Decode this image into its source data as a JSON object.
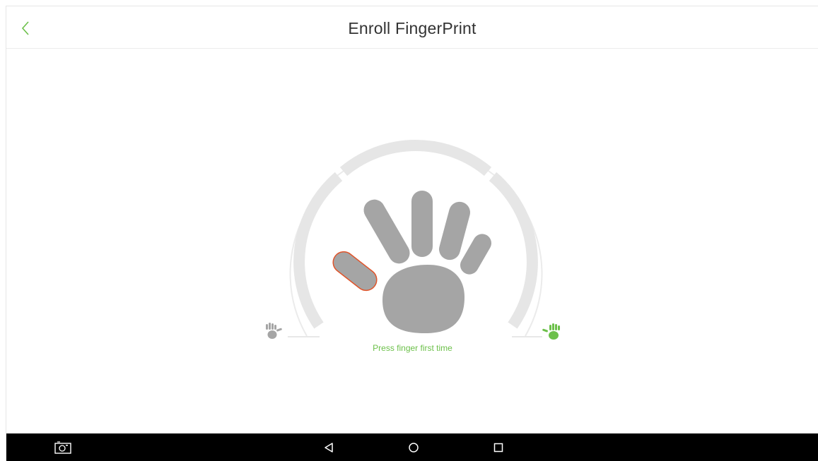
{
  "header": {
    "title": "Enroll FingerPrint",
    "back_icon": "chevron-left-icon"
  },
  "enroll": {
    "status_text": "Press finger first time",
    "selected_finger": "left-thumb",
    "progress_fraction": 0,
    "colors": {
      "accent": "#6cc04a",
      "hand": "#a5a5a5",
      "selected_outline": "#e0542a",
      "track": "#e6e6e6",
      "outer_ring": "#ebebeb"
    },
    "left_hand_icon": "left-hand-icon",
    "right_hand_icon": "right-hand-icon"
  },
  "navbar": {
    "items": [
      {
        "icon": "screenshot-icon"
      },
      {
        "icon": "back-triangle-icon"
      },
      {
        "icon": "home-circle-icon"
      },
      {
        "icon": "recents-square-icon"
      }
    ]
  }
}
